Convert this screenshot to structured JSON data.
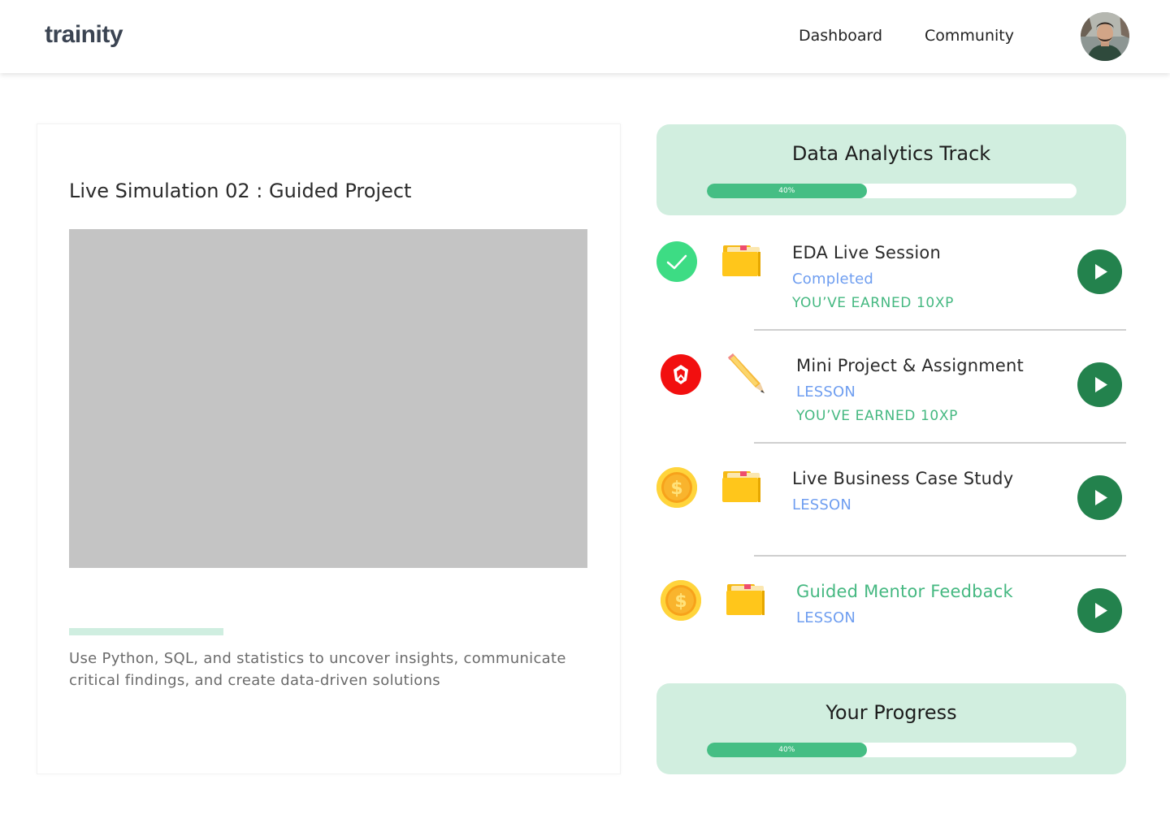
{
  "header": {
    "logo": "trainity",
    "nav": {
      "dashboard": "Dashboard",
      "community": "Community"
    }
  },
  "simulation": {
    "title": "Live Simulation 02 : Guided Project",
    "description": "Use Python, SQL, and statistics to uncover insights, communicate critical findings, and create data-driven solutions"
  },
  "track": {
    "title": "Data Analytics Track",
    "progress_label": "40%",
    "progress_value": 0.4
  },
  "lessons": [
    {
      "title": "EDA Live Session",
      "status": "Completed",
      "xp": "YOU’VE EARNED 10XP",
      "status_icon": "check-icon",
      "type_icon": "folder-icon"
    },
    {
      "title": "Mini Project & Assignment",
      "status": "LESSON",
      "xp": "YOU’VE EARNED 10XP",
      "status_icon": "shield-icon",
      "type_icon": "pencil-icon"
    },
    {
      "title": "Live Business Case Study",
      "status": "LESSON",
      "status_icon": "coin-icon",
      "type_icon": "folder-icon"
    },
    {
      "title": "Guided Mentor Feedback",
      "status": "LESSON",
      "status_icon": "coin-icon",
      "type_icon": "folder-icon"
    }
  ],
  "progress": {
    "title": "Your Progress",
    "progress_label": "40%",
    "progress_value": 0.4
  },
  "colors": {
    "accent_green": "#45be84",
    "card_green": "#d1eedf",
    "play_green": "#23824d",
    "link_blue": "#6f9ef0",
    "highlight_title": "#45b881"
  }
}
